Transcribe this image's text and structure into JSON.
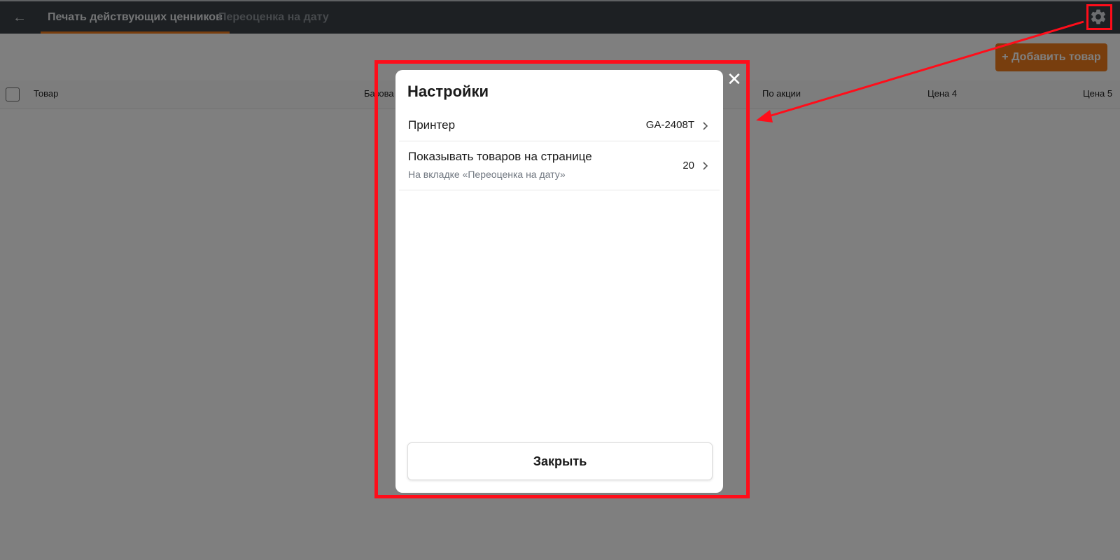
{
  "topbar": {
    "back_icon": "arrow-left-icon",
    "tabs": [
      {
        "label": "Печать действующих ценников",
        "active": true
      },
      {
        "label": "Переоценка на дату",
        "active": false
      }
    ],
    "settings_icon": "gear-icon"
  },
  "page": {
    "add_button_label": "+ Добавить товар",
    "table_headers": [
      "Товар",
      "Базова",
      "По акции",
      "Цена 4",
      "Цена 5"
    ]
  },
  "modal": {
    "title": "Настройки",
    "close_icon": "close-icon",
    "rows": [
      {
        "label": "Принтер",
        "value": "GA-2408T",
        "sublabel": ""
      },
      {
        "label": "Показывать товаров на странице",
        "value": "20",
        "sublabel": "На вкладке «Переоценка на дату»"
      }
    ],
    "close_button_label": "Закрыть"
  },
  "colors": {
    "accent": "#f07c1d",
    "topbar": "#3a4046",
    "annotation": "#ff0d1a"
  }
}
